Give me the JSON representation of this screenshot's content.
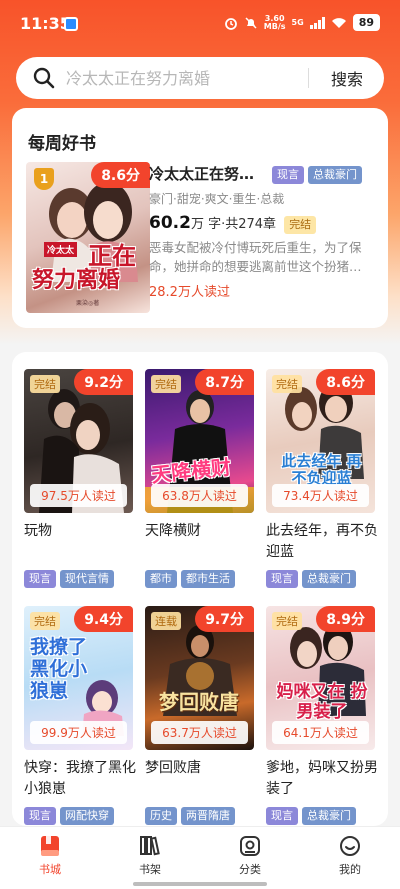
{
  "status_bar": {
    "time": "11:35",
    "net_speed": "3.60",
    "net_unit": "MB/s",
    "network": "5G",
    "battery": "89"
  },
  "search": {
    "placeholder": "冷太太正在努力离婚",
    "button": "搜索"
  },
  "weekly": {
    "section_title": "每周好书",
    "book": {
      "rank": "1",
      "score": "8.6分",
      "title": "冷太太正在努…",
      "tags": [
        "现言",
        "总裁豪门"
      ],
      "subtags": "豪门·甜宠·爽文·重生·总裁",
      "word_count": "60.2",
      "word_unit": "万 字",
      "chapters": "·共274章",
      "status": "完结",
      "description": "恶毒女配被冷付博玩死后重生，为了保命，她拼命的想要逃离前世这个扮猪…",
      "reads": "28.2万人读过",
      "cover_text": [
        "冷太太",
        "正在",
        "努力离婚"
      ],
      "cover_author": "栗染◎著"
    }
  },
  "books": [
    {
      "name": "玩物",
      "score": "9.2分",
      "status": "完结",
      "reads": "97.5万人读过",
      "tags": [
        "现言",
        "现代言情"
      ],
      "cover_text": ""
    },
    {
      "name": "天降横财",
      "score": "8.7分",
      "status": "完结",
      "reads": "63.8万人读过",
      "tags": [
        "都市",
        "都市生活"
      ],
      "cover_text": "天降横财"
    },
    {
      "name": "此去经年，再不负迎蓝",
      "score": "8.6分",
      "status": "完结",
      "reads": "73.4万人读过",
      "tags": [
        "现言",
        "总裁豪门"
      ],
      "cover_text": "此去经年 再不负迎蓝"
    },
    {
      "name": "快穿：我撩了黑化小狼崽",
      "score": "9.4分",
      "status": "完结",
      "reads": "99.9万人读过",
      "tags": [
        "现言",
        "网配快穿"
      ],
      "cover_text": "我撩了 黑化小 狼崽"
    },
    {
      "name": "梦回败唐",
      "score": "9.7分",
      "status": "连载",
      "reads": "63.7万人读过",
      "tags": [
        "历史",
        "两晋隋唐"
      ],
      "cover_text": "梦回败唐"
    },
    {
      "name": "爹地，妈咪又扮男装了",
      "score": "8.9分",
      "status": "完结",
      "reads": "64.1万人读过",
      "tags": [
        "现言",
        "总裁豪门"
      ],
      "cover_text": "妈咪又在 扮男装了"
    }
  ],
  "tabbar": [
    {
      "label": "书城",
      "icon": "bookstore-icon",
      "active": true
    },
    {
      "label": "书架",
      "icon": "bookshelf-icon",
      "active": false
    },
    {
      "label": "分类",
      "icon": "category-icon",
      "active": false
    },
    {
      "label": "我的",
      "icon": "profile-icon",
      "active": false
    }
  ],
  "colors": {
    "accent": "#f2442c",
    "header_gradient_top": "#f8532a",
    "tag_purple": "#8c88d9",
    "tag_blue": "#7494cc"
  }
}
